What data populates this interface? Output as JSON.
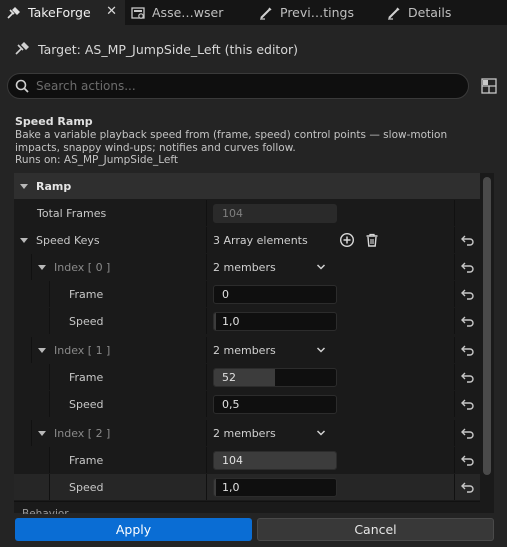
{
  "tabs": [
    {
      "label": "TakeForge",
      "active": true,
      "icon": "takeforge-icon",
      "close": "✕"
    },
    {
      "label": "Asse…wser",
      "active": false,
      "icon": "asset-browser-icon"
    },
    {
      "label": "Previ…tings",
      "active": false,
      "icon": "preview-settings-icon"
    },
    {
      "label": "Details",
      "active": false,
      "icon": "details-icon"
    }
  ],
  "target": {
    "text": "Target: AS_MP_JumpSide_Left (this editor)",
    "icon": "target-icon"
  },
  "search": {
    "placeholder": "Search actions...",
    "value": ""
  },
  "section": {
    "title": "Speed Ramp",
    "description": "Bake a variable playback speed from (frame, speed) control points — slow-motion impacts, snappy wind-ups; notifies and curves follow.",
    "runs_on": "Runs on: AS_MP_JumpSide_Left"
  },
  "details": {
    "category": "Ramp",
    "total_frames": {
      "label": "Total Frames",
      "value": "104"
    },
    "speed_keys": {
      "label": "Speed Keys",
      "summary": "3 Array elements"
    },
    "elements": [
      {
        "label": "Index [ 0 ]",
        "summary": "2 members",
        "frame": "0",
        "frame_fill": 0.0,
        "speed": "1,0",
        "speed_fill": 0.02
      },
      {
        "label": "Index [ 1 ]",
        "summary": "2 members",
        "frame": "52",
        "frame_fill": 0.5,
        "speed": "0,5",
        "speed_fill": 0.0
      },
      {
        "label": "Index [ 2 ]",
        "summary": "2 members",
        "frame": "104",
        "frame_fill": 1.0,
        "speed": "1,0",
        "speed_fill": 0.02
      }
    ],
    "frame_label": "Frame",
    "speed_label": "Speed",
    "next_category_peek": "Behavior"
  },
  "buttons": {
    "apply": "Apply",
    "cancel": "Cancel"
  },
  "colors": {
    "accent": "#0a6dd4",
    "background": "#242424",
    "field": "#0f0f0f"
  }
}
